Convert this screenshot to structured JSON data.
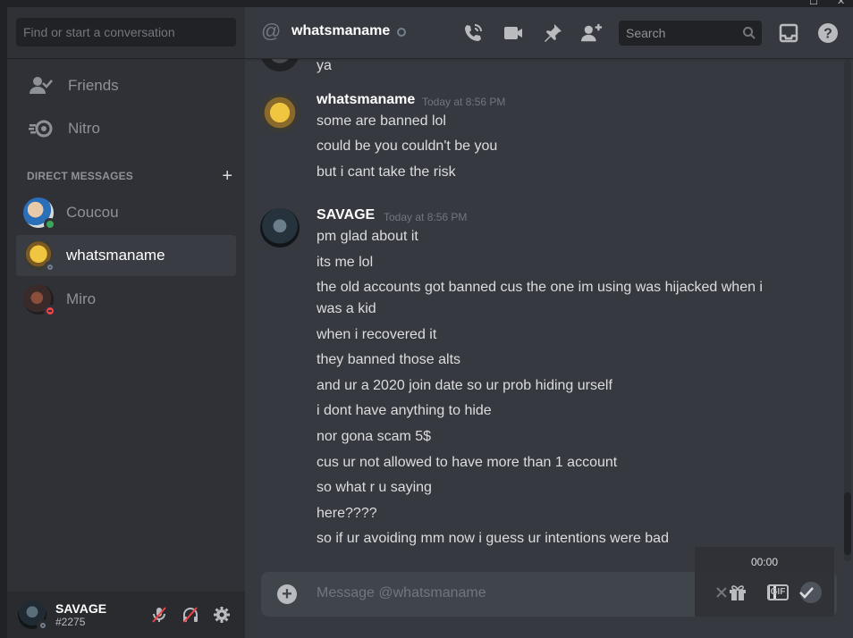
{
  "sidebar": {
    "search_placeholder": "Find or start a conversation",
    "nav": [
      {
        "label": "Friends",
        "icon": "friends-icon"
      },
      {
        "label": "Nitro",
        "icon": "nitro-icon"
      }
    ],
    "dm_header": "DIRECT MESSAGES",
    "dms": [
      {
        "label": "Coucou",
        "status": "online",
        "status_color": "#3ba55c"
      },
      {
        "label": "whatsmaname",
        "status": "offline",
        "status_color": "#747f8d",
        "active": true
      },
      {
        "label": "Miro",
        "status": "dnd",
        "status_color": "#ed4245"
      }
    ],
    "user": {
      "name": "SAVAGE",
      "tag": "#2275",
      "status_color": "#747f8d"
    }
  },
  "header": {
    "channel": "whatsmaname",
    "search_placeholder": "Search"
  },
  "messages": {
    "top_fragment": "ya",
    "groups": [
      {
        "author": "whatsmaname",
        "time": "Today at 8:56 PM",
        "lines": [
          "some are banned lol",
          "could be you couldn't be you",
          "but i cant take the risk"
        ]
      },
      {
        "author": "SAVAGE",
        "time": "Today at 8:56 PM",
        "lines": [
          "pm glad about it",
          "its me lol",
          "the old accounts got banned cus the one im using was hijacked when i",
          "was a kid",
          "when i recovered it",
          "they banned those alts",
          "and ur a 2020 join date so ur prob hiding urself",
          "i dont have anything to hide",
          "nor gona scam 5$",
          "cus ur not allowed to have more than 1 account",
          "so what r u saying",
          "here????",
          "so if ur avoiding mm now i guess ur intentions were bad"
        ]
      }
    ]
  },
  "composer": {
    "placeholder": "Message @whatsmaname"
  },
  "overlay": {
    "timer": "00:00",
    "gif_label": "GIF"
  },
  "colors": {
    "accent": "#ffffff",
    "background": "#36393f",
    "sidebar": "#2f3136"
  }
}
